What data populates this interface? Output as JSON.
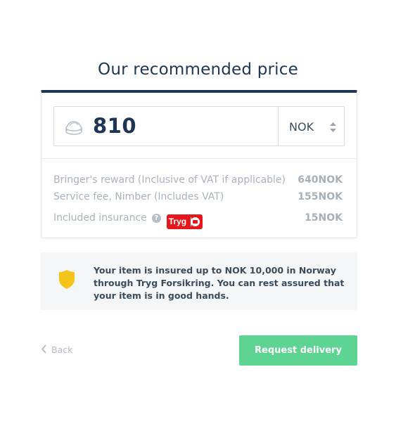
{
  "page": {
    "title": "Our recommended price"
  },
  "price": {
    "value": "810",
    "currency": "NOK"
  },
  "fees": [
    {
      "label": "Bringer's reward (Inclusive of VAT if applicable)",
      "amount": "640NOK"
    },
    {
      "label": "Service fee, Nimber (Includes VAT)",
      "amount": "155NOK"
    },
    {
      "label": "Included insurance",
      "amount": "15NOK",
      "help_icon": "?",
      "badge_text": "Tryg"
    }
  ],
  "insurance_notice": {
    "text": "Your item is insured up to NOK 10,000 in Norway through Tryg Forsikring. You can rest assured that your item is in good hands."
  },
  "actions": {
    "back_label": "Back",
    "submit_label": "Request delivery"
  },
  "colors": {
    "accent_navy": "#1c3653",
    "submit_green": "#5ed493",
    "shield_yellow": "#f6c31a",
    "tryg_red": "#e5161c"
  },
  "icons": [
    "coin-stack-icon",
    "sort-icon",
    "help-icon",
    "tryg-logo",
    "shield-icon",
    "chevron-left-icon"
  ]
}
